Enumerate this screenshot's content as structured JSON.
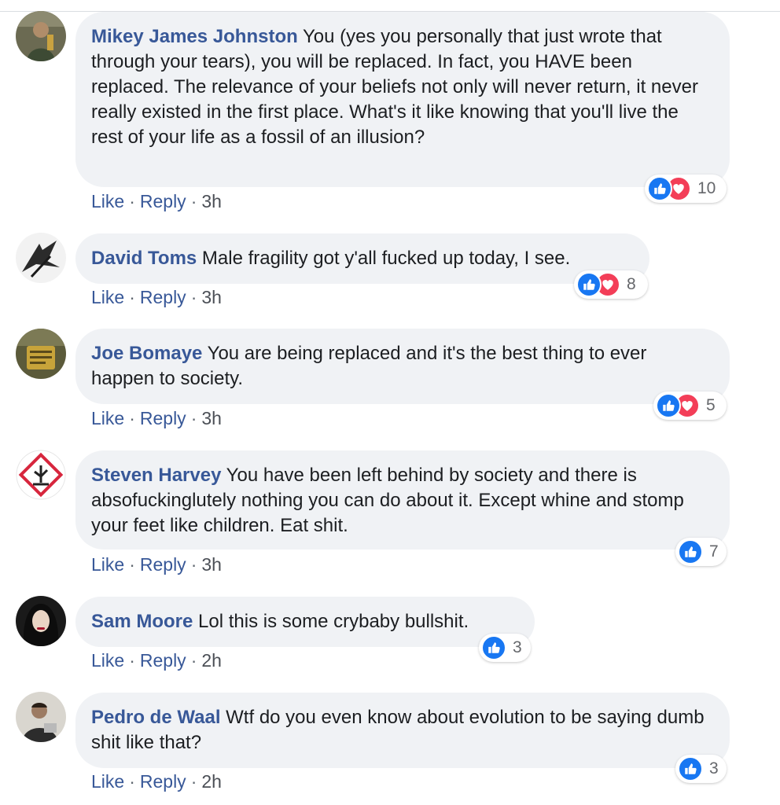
{
  "colors": {
    "author": "#385898",
    "bubble": "#f0f2f5",
    "like": "#1877f2",
    "love": "#f33e58"
  },
  "comments": [
    {
      "author": "Mikey James Johnston",
      "text": "You (yes you personally that just wrote that through your tears), you will be replaced. In fact, you HAVE been replaced. The relevance of your beliefs not only will never return, it never really existed in the first place. What's it like knowing that you'll live the rest of your life as a fossil of an illusion?",
      "like_label": "Like",
      "reply_label": "Reply",
      "time": "3h",
      "reactions": [
        "like-icon",
        "love-icon"
      ],
      "reaction_count": "10"
    },
    {
      "author": "David Toms",
      "text": "Male fragility got y'all fucked up today, I see.",
      "like_label": "Like",
      "reply_label": "Reply",
      "time": "3h",
      "reactions": [
        "like-icon",
        "love-icon"
      ],
      "reaction_count": "8"
    },
    {
      "author": "Joe Bomaye",
      "text": "You are being replaced and it's the best thing to ever happen to society.",
      "like_label": "Like",
      "reply_label": "Reply",
      "time": "3h",
      "reactions": [
        "like-icon",
        "love-icon"
      ],
      "reaction_count": "5"
    },
    {
      "author": "Steven Harvey",
      "text": "You have been left behind by society and there is absofuckinglutely nothing you can do about it. Except whine and stomp your feet like children. Eat shit.",
      "like_label": "Like",
      "reply_label": "Reply",
      "time": "3h",
      "reactions": [
        "like-icon"
      ],
      "reaction_count": "7"
    },
    {
      "author": "Sam Moore",
      "text": "Lol this is some crybaby bullshit.",
      "like_label": "Like",
      "reply_label": "Reply",
      "time": "2h",
      "reactions": [
        "like-icon"
      ],
      "reaction_count": "3"
    },
    {
      "author": "Pedro de Waal",
      "text": "Wtf do you even know about evolution to be saying dumb shit like that?",
      "like_label": "Like",
      "reply_label": "Reply",
      "time": "2h",
      "reactions": [
        "like-icon"
      ],
      "reaction_count": "3"
    }
  ]
}
